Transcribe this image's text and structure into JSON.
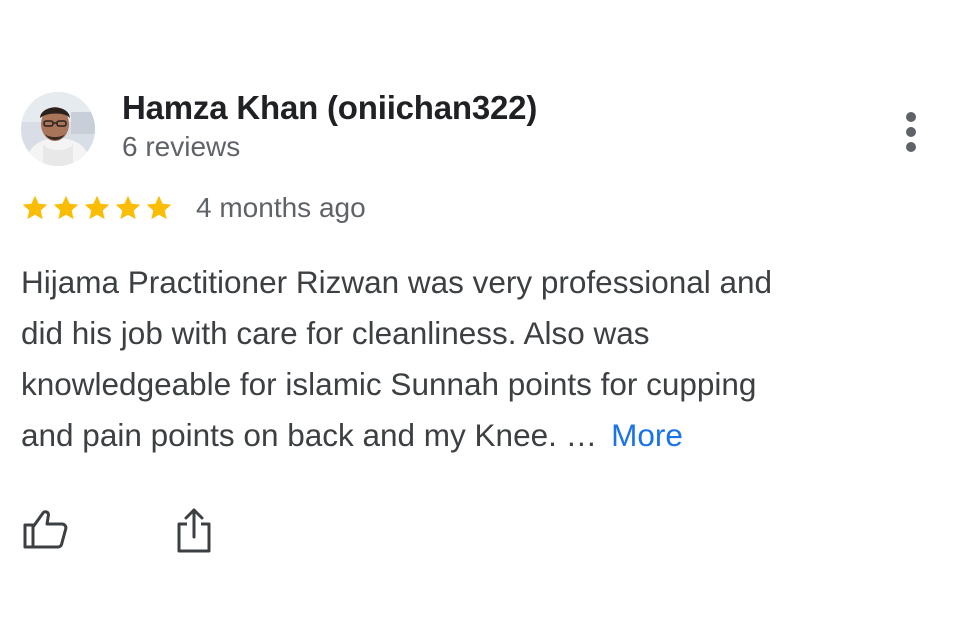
{
  "review": {
    "author": {
      "name": "Hamza Khan (oniichan322)",
      "review_count": "6 reviews",
      "avatar_icon": "user-avatar-photo"
    },
    "rating": 5,
    "rating_max": 5,
    "date": "4 months ago",
    "text_lines": [
      "Hijama Practitioner Rizwan was very professional and",
      "did his job with care for cleanliness. Also was",
      "knowledgeable for islamic Sunnah points for cupping",
      "and pain points on back and my Knee. …"
    ],
    "more_label": "More",
    "actions": {
      "like_icon": "thumbs-up-icon",
      "share_icon": "share-icon",
      "menu_icon": "more-vert-icon"
    }
  },
  "colors": {
    "star": "#fbbc04",
    "link": "#1a73e8",
    "primary_text": "#202124",
    "secondary_text": "#5f6368"
  }
}
